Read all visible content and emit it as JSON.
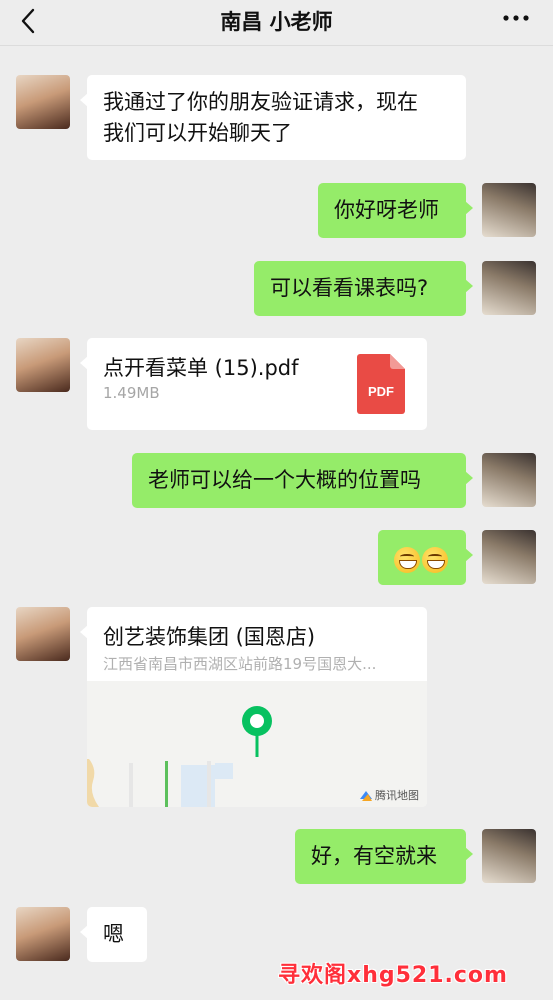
{
  "header": {
    "title": "南昌 小老师",
    "back_icon": "chevron-left-icon",
    "more_icon": "more-dots-icon"
  },
  "messages": [
    {
      "side": "left",
      "type": "text",
      "text_line1": "我通过了你的朋友验证请求，现在",
      "text_line2": "我们可以开始聊天了"
    },
    {
      "side": "right",
      "type": "text",
      "text": "你好呀老师"
    },
    {
      "side": "right",
      "type": "text",
      "text": "可以看看课表吗?"
    },
    {
      "side": "left",
      "type": "file",
      "file_name": "点开看菜单 (15).pdf",
      "file_size": "1.49MB",
      "icon_label": "PDF"
    },
    {
      "side": "right",
      "type": "text",
      "text": "老师可以给一个大概的位置吗"
    },
    {
      "side": "right",
      "type": "emoji",
      "emoji_icon": "grin-emoji-icon"
    },
    {
      "side": "left",
      "type": "location",
      "name": "创艺装饰集团 (国恩店)",
      "address": "江西省南昌市西湖区站前路19号国恩大...",
      "map_credit": "腾讯地图"
    },
    {
      "side": "right",
      "type": "text",
      "text": "好，有空就来"
    },
    {
      "side": "left",
      "type": "text",
      "text": "嗯"
    }
  ],
  "watermark": "寻欢阁xhg521.com",
  "colors": {
    "background": "#ededed",
    "bubble_self": "#95ec69",
    "bubble_other": "#ffffff",
    "pdf_red": "#e94b45",
    "map_pin": "#07c160",
    "watermark": "#ff2f3a"
  }
}
